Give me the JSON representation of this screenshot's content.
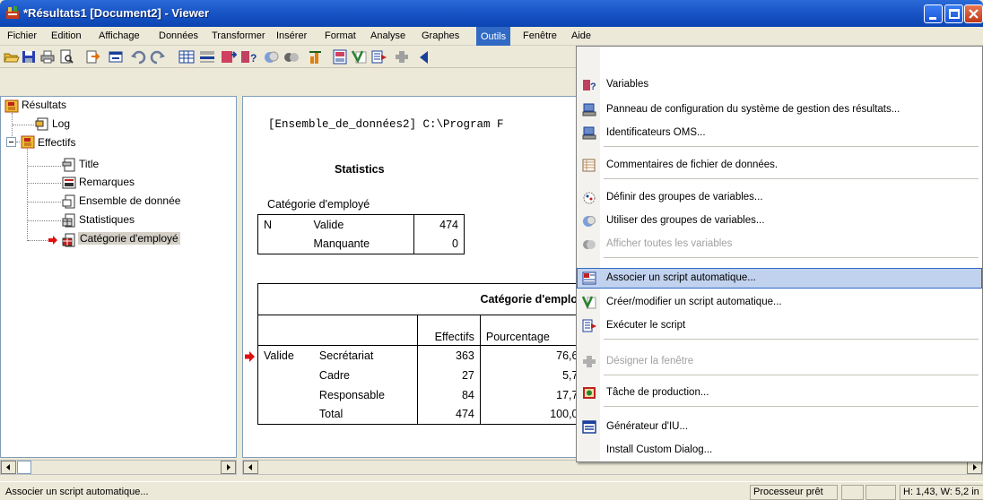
{
  "window": {
    "title": "*Résultats1 [Document2] - Viewer"
  },
  "menubar": {
    "items": [
      {
        "label": "Fichier"
      },
      {
        "label": "Edition"
      },
      {
        "label": "Affichage"
      },
      {
        "label": "Données"
      },
      {
        "label": "Transformer"
      },
      {
        "label": "Insérer"
      },
      {
        "label": "Format"
      },
      {
        "label": "Analyse"
      },
      {
        "label": "Graphes"
      },
      {
        "label": "Outils"
      },
      {
        "label": "Fenêtre"
      },
      {
        "label": "Aide"
      }
    ],
    "active": "Outils"
  },
  "toolbar": {
    "icons": [
      "open-icon",
      "save-icon",
      "print-icon",
      "print-preview-icon",
      "export-icon",
      "recall-dialog-icon",
      "undo-icon",
      "redo-icon",
      "goto-data-icon",
      "goto-case-icon",
      "goto-variable-icon",
      "variables-icon",
      "use-sets-icon",
      "show-all-icon",
      "pivot-icon",
      "insert-heading-icon",
      "insert-text-icon",
      "run-script-icon",
      "designate-icon"
    ]
  },
  "tree": {
    "root": "Résultats",
    "log": "Log",
    "group": "Effectifs",
    "children": [
      "Title",
      "Remarques",
      "Ensemble de donnée",
      "Statistiques",
      "Catégorie d'employé"
    ],
    "selected": "Catégorie d'employé"
  },
  "output": {
    "dataset_line": "[Ensemble_de_données2] C:\\Program F",
    "stats_title": "Statistics",
    "stats_caption": "Catégorie d'employé",
    "stats_rows": [
      {
        "c1": "N",
        "c2": "Valide",
        "c3": "474"
      },
      {
        "c1": "",
        "c2": "Manquante",
        "c3": "0"
      }
    ],
    "freq_title": "Catégorie d'emplo",
    "freq_headers": [
      "Effectifs",
      "Pourcentage"
    ],
    "freq_rows": [
      {
        "c1": "Valide",
        "c2": "Secrétariat",
        "c3": "363",
        "c4": "76,6"
      },
      {
        "c1": "",
        "c2": "Cadre",
        "c3": "27",
        "c4": "5,7"
      },
      {
        "c1": "",
        "c2": "Responsable",
        "c3": "84",
        "c4": "17,7"
      },
      {
        "c1": "",
        "c2": "Total",
        "c3": "474",
        "c4": "100,0"
      }
    ]
  },
  "tools_menu": {
    "items": [
      {
        "label": "Variables",
        "icon": "variables-icon",
        "state": "normal"
      },
      {
        "label": "Panneau de configuration du système de gestion des résultats...",
        "icon": "oms-control-panel-icon",
        "state": "normal"
      },
      {
        "label": "Identificateurs OMS...",
        "icon": "oms-identifiers-icon",
        "state": "normal"
      },
      {
        "label": "Commentaires de fichier de données.",
        "icon": "data-file-comments-icon",
        "state": "normal"
      },
      {
        "label": "Définir des groupes de variables...",
        "icon": "define-variable-sets-icon",
        "state": "normal"
      },
      {
        "label": "Utiliser des groupes de variables...",
        "icon": "use-variable-sets-icon",
        "state": "normal"
      },
      {
        "label": "Afficher toutes les variables",
        "icon": "show-all-variables-icon",
        "state": "disabled"
      },
      {
        "label": "Associer un script automatique...",
        "icon": "assign-autoscript-icon",
        "state": "hover"
      },
      {
        "label": "Créer/modifier un script automatique...",
        "icon": "edit-autoscript-icon",
        "state": "normal"
      },
      {
        "label": "Exécuter le script",
        "icon": "run-script-icon",
        "state": "normal"
      },
      {
        "label": "Désigner la fenêtre",
        "icon": "designate-window-icon",
        "state": "disabled"
      },
      {
        "label": "Tâche de production...",
        "icon": "production-job-icon",
        "state": "normal"
      },
      {
        "label": "Générateur d'IU...",
        "icon": "ui-builder-icon",
        "state": "normal"
      },
      {
        "label": "Install Custom Dialog...",
        "icon": "",
        "state": "normal"
      }
    ]
  },
  "statusbar": {
    "message": "Associer un script automatique...",
    "processor": "Processeur prêt",
    "dimensions": "H: 1,43, W: 5,2 in"
  }
}
